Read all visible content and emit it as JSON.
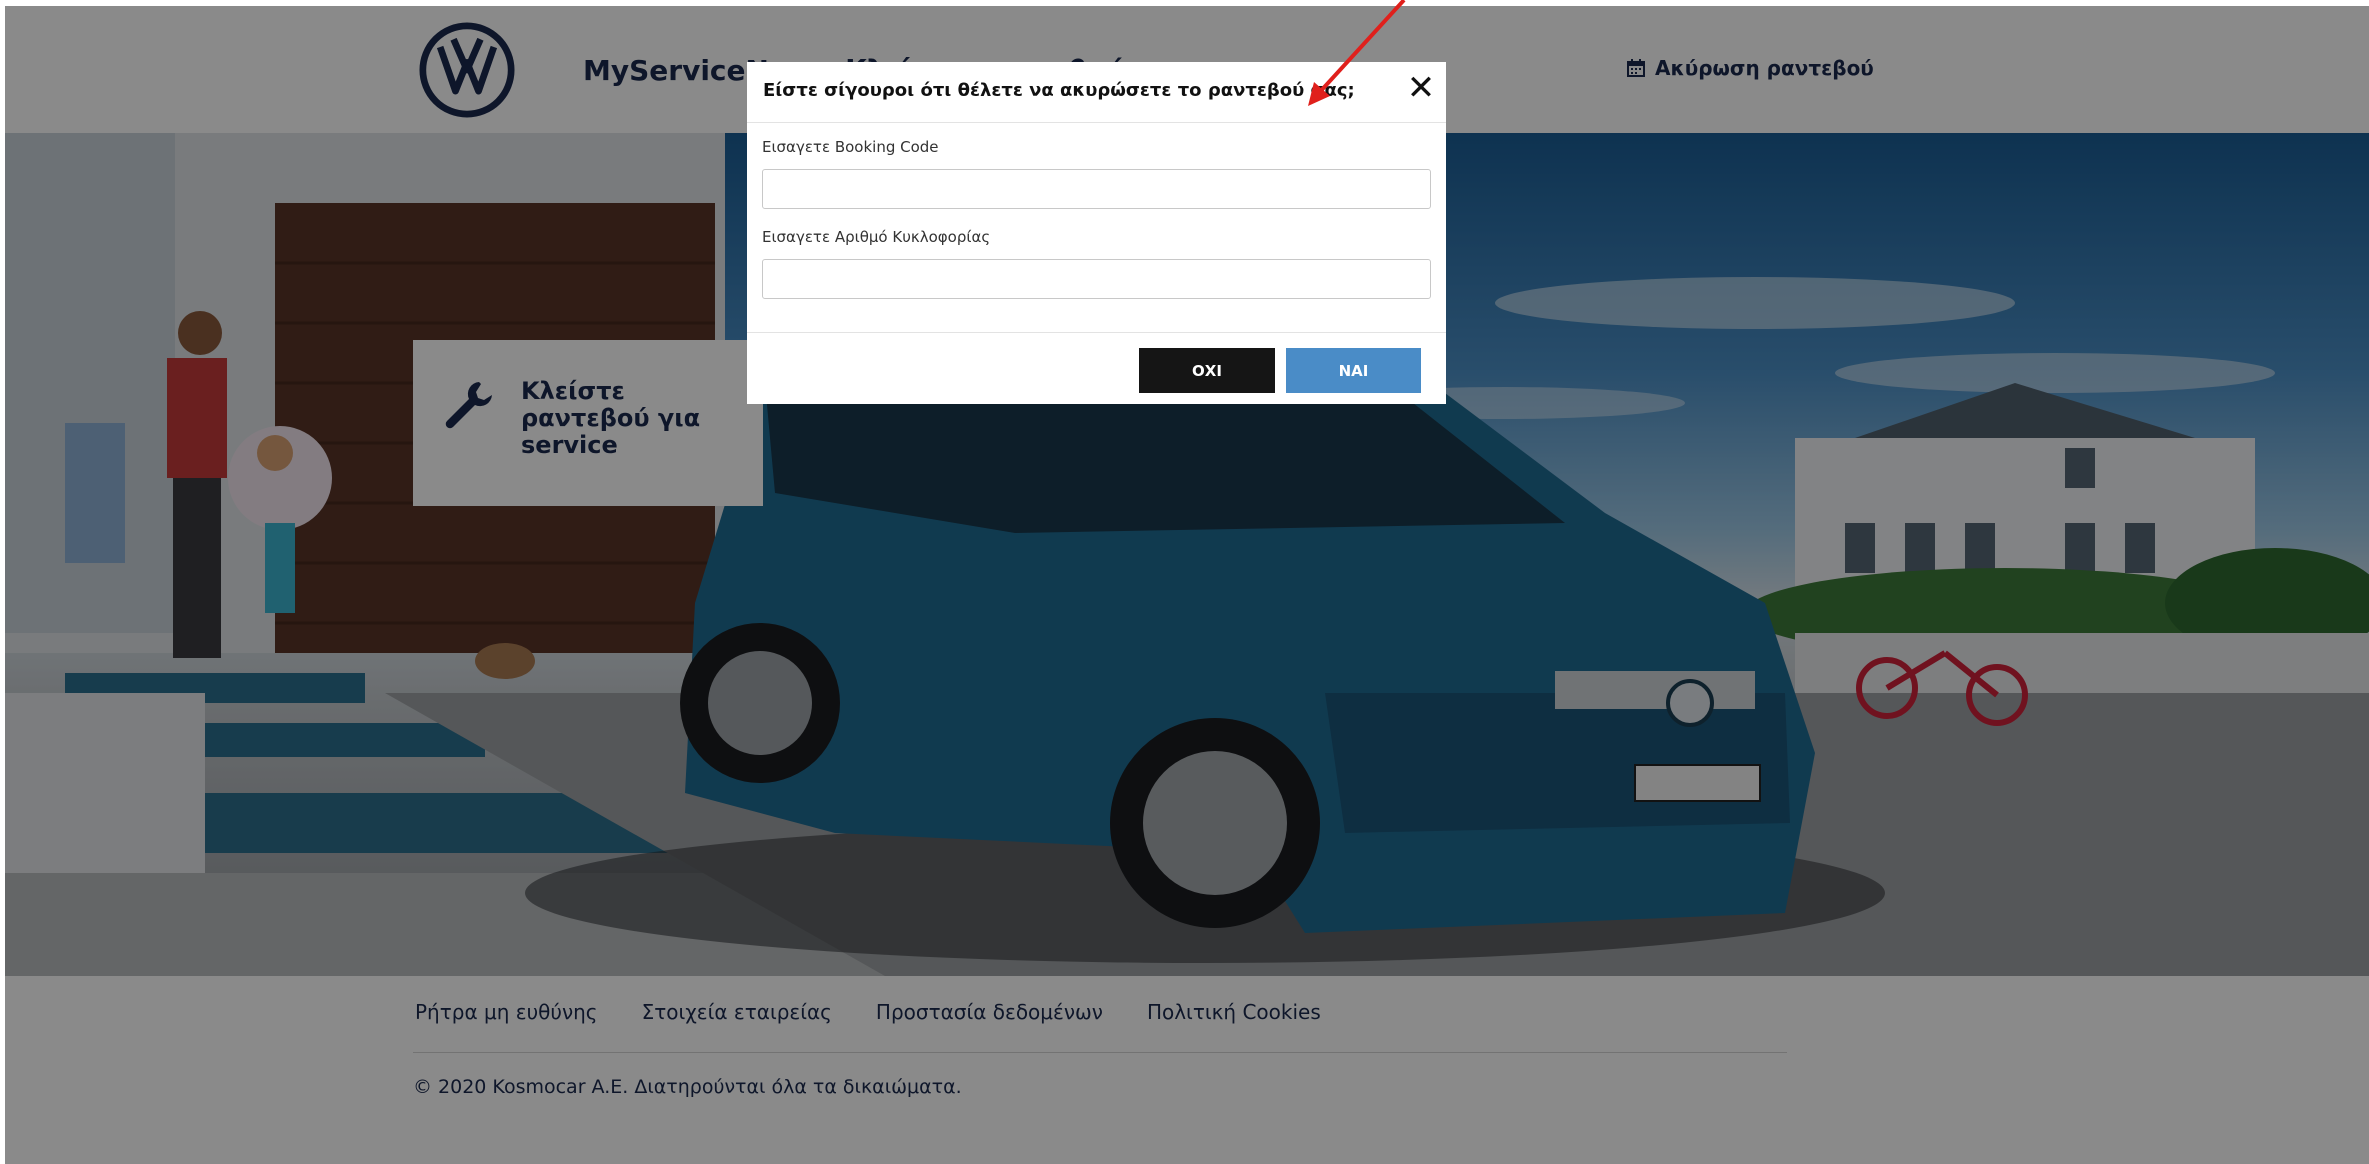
{
  "header": {
    "title": "MyServiceNow - Κλείστε ραντεβού",
    "cancel_appointment": "Ακύρωση ραντεβού"
  },
  "hero": {
    "booking_card_label": "Κλείστε ραντεβού για service"
  },
  "modal": {
    "title": "Είστε σίγουροι ότι θέλετε να ακυρώσετε το ραντεβού σας;",
    "close_symbol": "✕",
    "booking_code_label": "Εισαγετε Booking Code",
    "booking_code_value": "",
    "plate_label": "Εισαγετε Αριθμό Κυκλοφορίας",
    "plate_value": "",
    "no_label": "ΟΧΙ",
    "yes_label": "ΝΑΙ"
  },
  "footer": {
    "links": [
      "Ρήτρα μη ευθύνης",
      "Στοιχεία εταιρείας",
      "Προστασία δεδομένων",
      "Πολιτική Cookies"
    ],
    "copyright": "© 2020 Kosmocar A.E. Διατηρούνται όλα τα δικαιώματα."
  },
  "icons": {
    "logo": "vw-logo",
    "calendar": "calendar-icon",
    "wrench": "wrench-icon",
    "close": "close-icon",
    "annotation": "red-arrow-annotation"
  },
  "colors": {
    "brand_navy": "#1b2a4e",
    "yes_button": "#4a8cc7",
    "no_button": "#151515",
    "annotation_arrow": "#e0201c"
  }
}
